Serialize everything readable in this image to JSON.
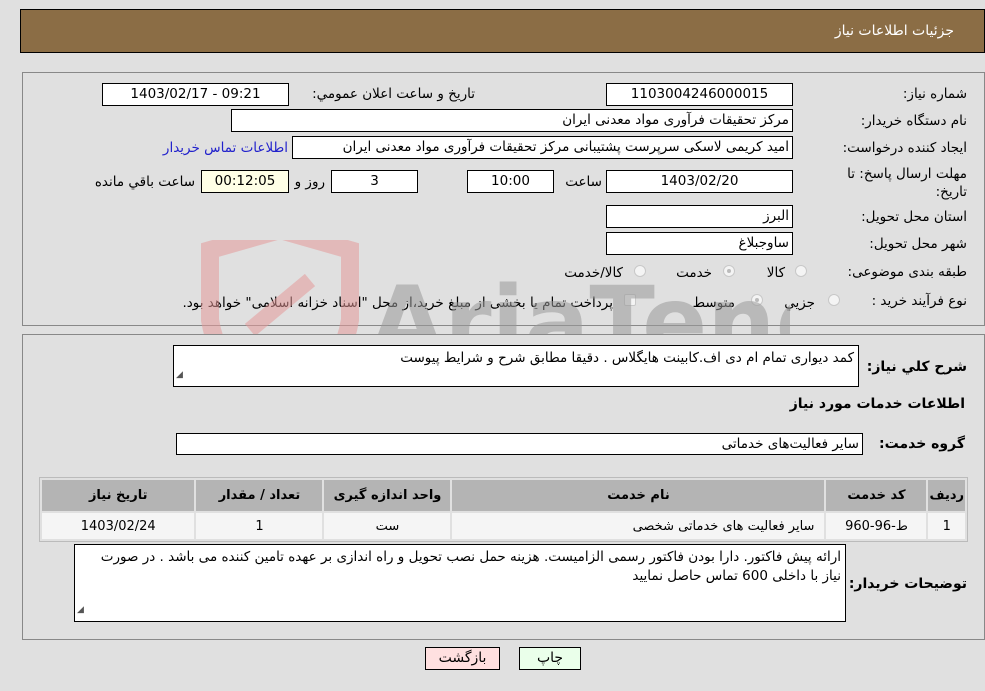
{
  "header": {
    "title": "جزئیات اطلاعات نیاز"
  },
  "details": {
    "need_number_label": "شماره نیاز:",
    "need_number": "1103004246000015",
    "announce_label": "تاریخ و ساعت اعلان عمومي:",
    "announce_value": "1403/02/17 - 09:21",
    "buyer_org_label": "نام دستگاه خریدار:",
    "buyer_org": "مرکز تحقیقات فرآوری مواد معدنی ایران",
    "creator_label": "ایجاد کننده درخواست:",
    "creator": "امید کریمی لاسکی سرپرست پشتیبانی مرکز تحقیقات فرآوری مواد معدنی ایران",
    "contact_link": "اطلاعات تماس خریدار",
    "deadline_label": "مهلت ارسال پاسخ: تا تاریخ:",
    "deadline_date": "1403/02/20",
    "time_label": "ساعت",
    "deadline_time": "10:00",
    "days_value": "3",
    "days_label": "روز و",
    "remaining_time": "00:12:05",
    "remaining_label": "ساعت باقي مانده",
    "province_label": "استان محل تحویل:",
    "province": "البرز",
    "city_label": "شهر محل تحویل:",
    "city": "ساوجبلاغ",
    "category_label": "طبقه بندی موضوعی:",
    "category_options": [
      {
        "label": "کالا",
        "checked": false
      },
      {
        "label": "خدمت",
        "checked": true
      },
      {
        "label": "کالا/خدمت",
        "checked": false
      }
    ],
    "process_label": "نوع فرآیند خرید :",
    "process_options": [
      {
        "label": "جزيي",
        "checked": false
      },
      {
        "label": "متوسط",
        "checked": true
      }
    ],
    "treasury_note": "پرداخت تمام یا بخشی از مبلغ خرید،از محل \"اسناد خزانه اسلامی\" خواهد بود."
  },
  "description": {
    "label": "شرح کلي نیاز:",
    "value": "کمد دیواری تمام ام دی اف.کابینت هایگلاس . دقیقا مطابق شرح و شرایط پیوست"
  },
  "services": {
    "section_title": "اطلاعات خدمات مورد نیاز",
    "group_label": "گروه خدمت:",
    "group_value": "سایر فعالیت‌های خدماتی",
    "columns": [
      "ردیف",
      "کد خدمت",
      "نام خدمت",
      "واحد اندازه گیری",
      "تعداد / مقدار",
      "تاریخ نیاز"
    ],
    "rows": [
      [
        "1",
        "ط-96-960",
        "سایر فعالیت های خدماتی شخصی",
        "ست",
        "1",
        "1403/02/24"
      ]
    ]
  },
  "buyer_notes": {
    "label": "توضیحات خریدار:",
    "value": "ارائه پیش فاکتور. دارا بودن فاکتور رسمی الزامیست. هزینه حمل نصب تحویل و راه اندازی بر عهده تامین کننده می باشد . در صورت نیاز با داخلی 600 تماس حاصل نمایید"
  },
  "buttons": {
    "print": "چاپ",
    "back": "بازگشت"
  },
  "watermark": {
    "text": "AriaTender.neT"
  }
}
